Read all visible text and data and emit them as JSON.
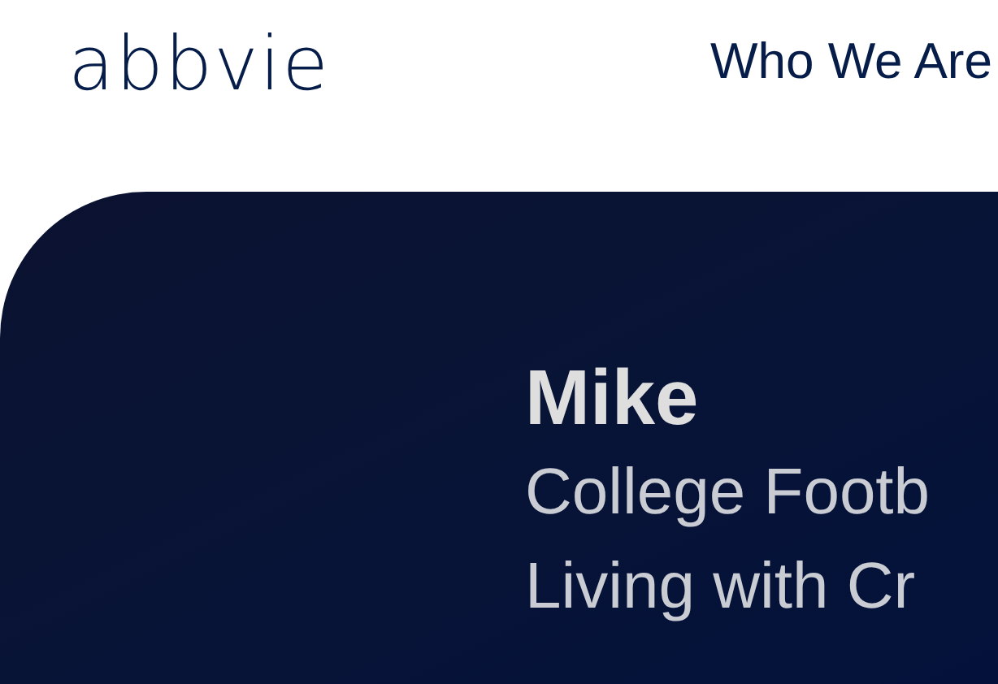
{
  "header": {
    "logo": "abbvie",
    "nav": [
      {
        "label": "Who We Are"
      }
    ]
  },
  "hero": {
    "name": "Mike",
    "lines": [
      "College Footb",
      "Living with Cr"
    ]
  }
}
